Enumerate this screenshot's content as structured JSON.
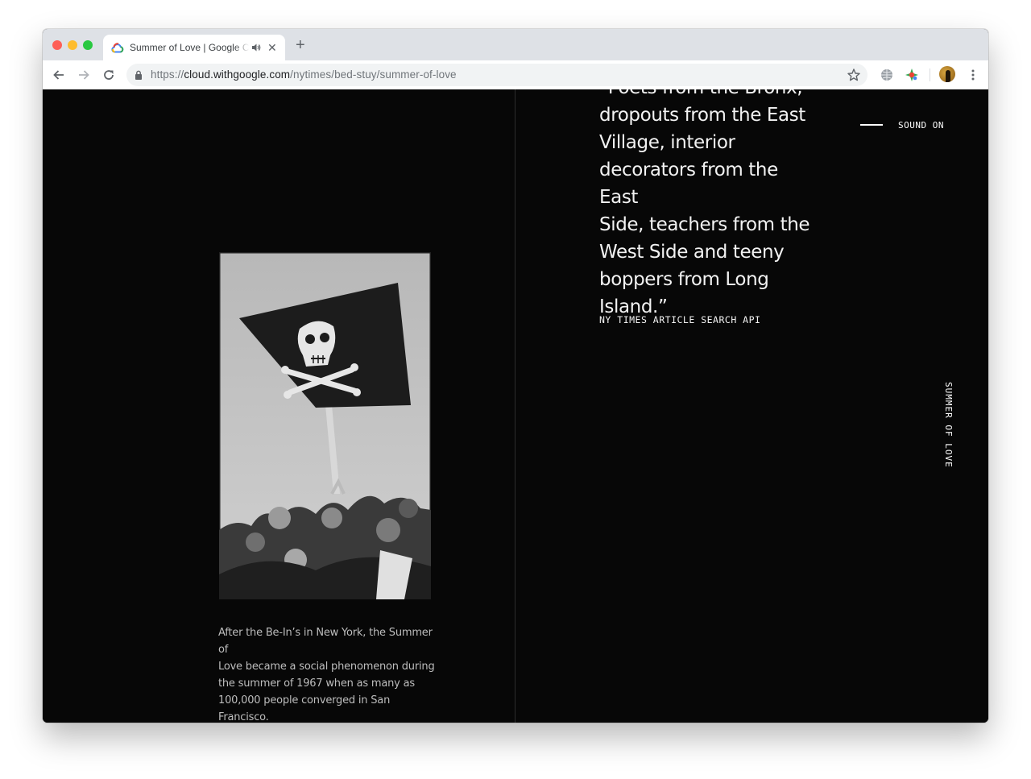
{
  "browser": {
    "tab": {
      "title": "Summer of Love | Google C",
      "favicon": "google-cloud-icon",
      "audio_icon": "speaker-icon",
      "close_icon": "close-icon"
    },
    "new_tab_icon": "plus-icon",
    "address_bar": {
      "url_scheme": "https://",
      "url_host": "cloud.withgoogle.com",
      "url_path": "/nytimes/bed-stuy/summer-of-love"
    },
    "toolbar_icons": [
      "back-arrow-icon",
      "forward-arrow-icon",
      "reload-icon",
      "lock-icon",
      "bookmark-star-icon",
      "globe-extension-icon",
      "color-extension-icon",
      "profile-avatar",
      "menu-dots-icon"
    ],
    "colors": {
      "tab_strip": "#dee1e6",
      "omnibox": "#f1f3f4",
      "traffic_red": "#fe5f57",
      "traffic_yellow": "#febc2e",
      "traffic_green": "#28c840"
    }
  },
  "page": {
    "background": "#070707",
    "quote_lines": [
      "“Poets from the Bronx,",
      "dropouts from the East",
      "Village, interior",
      "decorators from the East",
      "Side, teachers from the",
      "West Side and teeny",
      "boppers from Long",
      "Island.”"
    ],
    "quote_source": "NY TIMES ARTICLE SEARCH API",
    "sound_toggle": "SOUND ON",
    "vertical_title": "SUMMER OF LOVE",
    "photo": {
      "description_icon": "pirate-flag-crowd-photo"
    },
    "caption_lines": [
      "After the Be-In’s in New York, the Summer of",
      "Love became a social phenomenon during",
      "the summer of 1967 when as many as",
      "100,000 people converged in San",
      "Francisco."
    ]
  }
}
